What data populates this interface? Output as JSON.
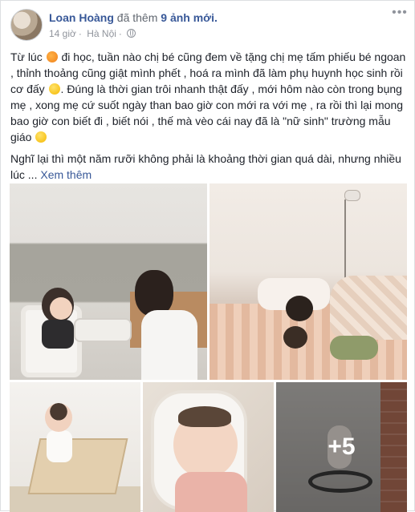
{
  "post": {
    "author": "Loan Hoàng",
    "action_prefix": "đã thêm",
    "action_highlight": "9 ảnh mới.",
    "time": "14 giờ",
    "location": "Hà Nội",
    "privacy_icon": "globe-icon",
    "menu_icon": "more-options-icon",
    "paragraph1_a": "Từ lúc",
    "paragraph1_b": "đi học, tuần nào chị bé cũng đem về tặng chị mẹ tấm phiếu bé ngoan , thỉnh thoảng cũng giật mình phết , hoá ra mình đã làm phụ huynh học sinh rồi cơ đấy",
    "paragraph1_c": ". Đúng là thời gian trôi nhanh thật đấy , mới hôm nào còn trong bụng mẹ , xong mẹ cứ suốt ngày than bao giờ con mới ra với mẹ , ra rồi thì lại mong bao giờ con biết đi , biết nói , thế mà vèo cái nay đã là \"nữ sinh\" trường mẫu giáo",
    "paragraph2": "Nghĩ lại thì một năm rưỡi không phải là khoảng thời gian quá dài, nhưng nhiều lúc ...",
    "see_more": "Xem thêm",
    "more_photos": "+5"
  }
}
